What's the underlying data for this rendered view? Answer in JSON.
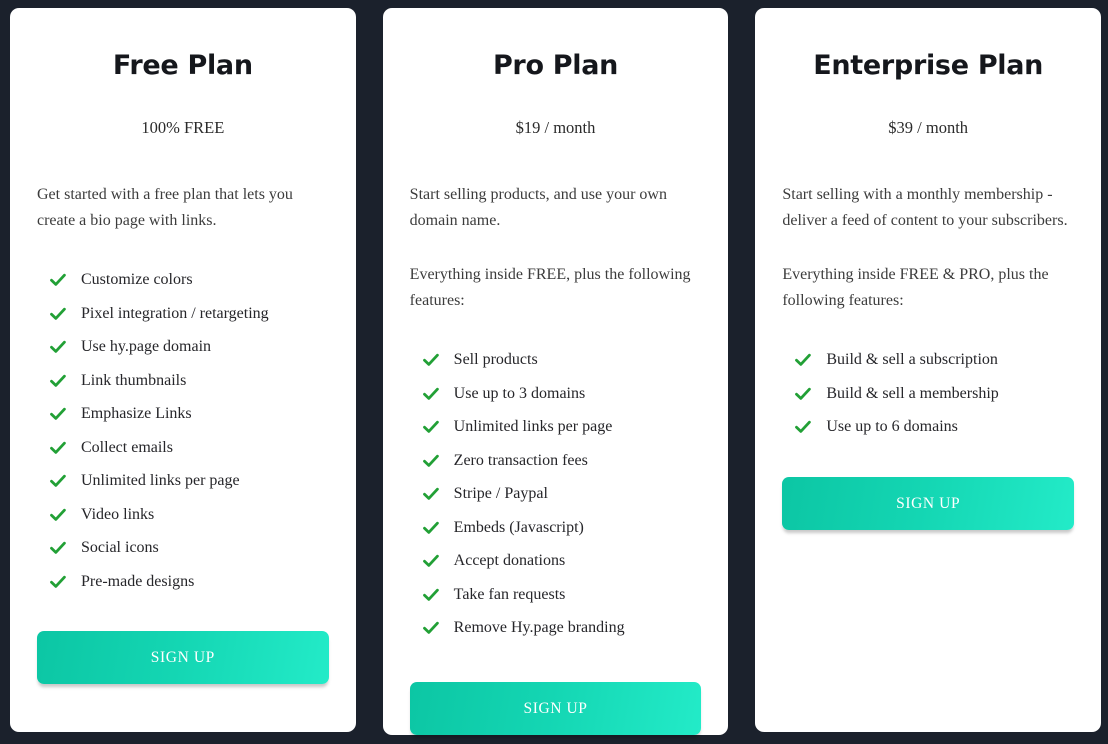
{
  "theme": {
    "page_background": "#1b212c",
    "card_background": "#ffffff",
    "check_color": "#22a036",
    "button_gradient_start": "#0cc6a4",
    "button_gradient_end": "#23ebc8",
    "title_color": "#15171c",
    "body_text_color": "#3c3c3c"
  },
  "plans": [
    {
      "title": "Free Plan",
      "price": "100% FREE",
      "descriptions": [
        "Get started with a free plan that lets you create a bio page with links."
      ],
      "features": [
        "Customize colors",
        "Pixel integration / retargeting",
        "Use hy.page domain",
        "Link thumbnails",
        "Emphasize Links",
        "Collect emails",
        "Unlimited links per page",
        "Video links",
        "Social icons",
        "Pre-made designs"
      ],
      "cta": "SIGN UP"
    },
    {
      "title": "Pro Plan",
      "price": "$19 / month",
      "descriptions": [
        "Start selling products, and use your own domain name.",
        "Everything inside FREE, plus the following features:"
      ],
      "features": [
        "Sell products",
        "Use up to 3 domains",
        "Unlimited links per page",
        "Zero transaction fees",
        "Stripe / Paypal",
        "Embeds (Javascript)",
        "Accept donations",
        "Take fan requests",
        "Remove Hy.page branding"
      ],
      "cta": "SIGN UP"
    },
    {
      "title": "Enterprise Plan",
      "price": "$39 / month",
      "descriptions": [
        "Start selling with a monthly membership - deliver a feed of content to your subscribers.",
        "Everything inside FREE & PRO, plus the following features:"
      ],
      "features": [
        "Build & sell a subscription",
        "Build & sell a membership",
        "Use up to 6 domains"
      ],
      "cta": "SIGN UP"
    }
  ]
}
